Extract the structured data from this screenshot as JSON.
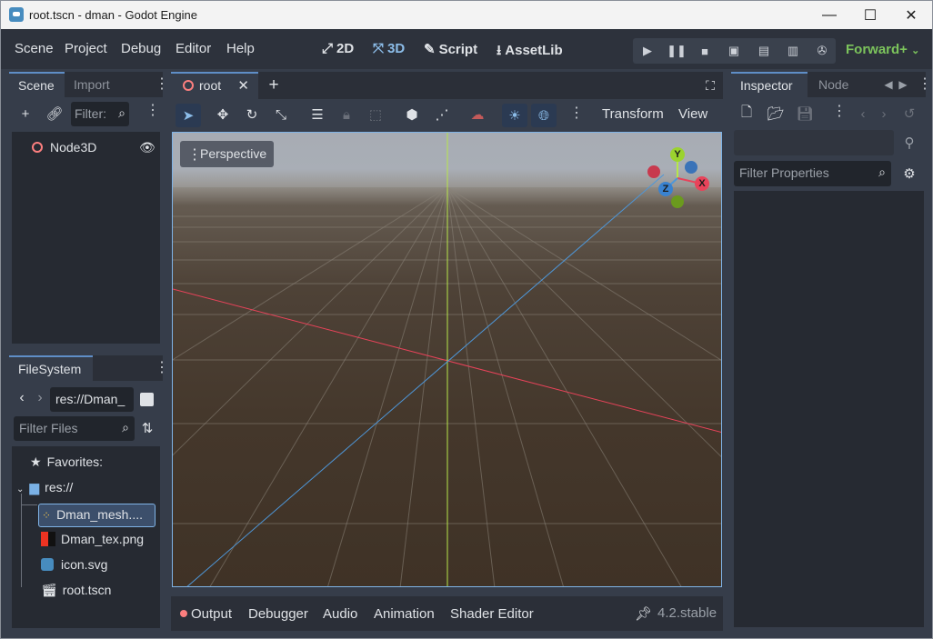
{
  "window": {
    "title": "root.tscn - dman - Godot Engine"
  },
  "menubar": {
    "items": [
      "Scene",
      "Project",
      "Debug",
      "Editor",
      "Help"
    ],
    "workspaces": [
      {
        "label": "2D",
        "icon": "2d-icon"
      },
      {
        "label": "3D",
        "icon": "3d-icon",
        "active": true
      },
      {
        "label": "Script",
        "icon": "script-icon"
      },
      {
        "label": "AssetLib",
        "icon": "assetlib-icon"
      }
    ],
    "renderer": "Forward+"
  },
  "scene_dock": {
    "tabs": [
      "Scene",
      "Import"
    ],
    "filter_placeholder": "Filter:",
    "tree": [
      {
        "label": "Node3D"
      }
    ]
  },
  "filesystem_dock": {
    "tab": "FileSystem",
    "path": "res://Dman_",
    "filter_placeholder": "Filter Files",
    "items": [
      {
        "label": "Favorites:"
      },
      {
        "label": "res://"
      },
      {
        "label": "Dman_mesh...."
      },
      {
        "label": "Dman_tex.png"
      },
      {
        "label": "icon.svg"
      },
      {
        "label": "root.tscn"
      }
    ]
  },
  "editor": {
    "scene_tab": "root",
    "toolbar": {
      "transform_label": "Transform",
      "view_label": "View"
    },
    "viewport": {
      "mode_label": "Perspective"
    },
    "gizmo": {
      "y": "Y",
      "z": "Z",
      "x": "X"
    }
  },
  "inspector_dock": {
    "tabs": [
      "Inspector",
      "Node"
    ],
    "filter_placeholder": "Filter Properties"
  },
  "bottom_panel": {
    "tabs": [
      "Output",
      "Debugger",
      "Audio",
      "Animation",
      "Shader Editor"
    ],
    "version": "4.2.stable"
  },
  "colors": {
    "accent": "#5f8ec7",
    "x_axis": "#e8435a",
    "y_axis": "#b7e64a",
    "z_axis": "#4e97d9",
    "renderer": "#7cc45c"
  }
}
